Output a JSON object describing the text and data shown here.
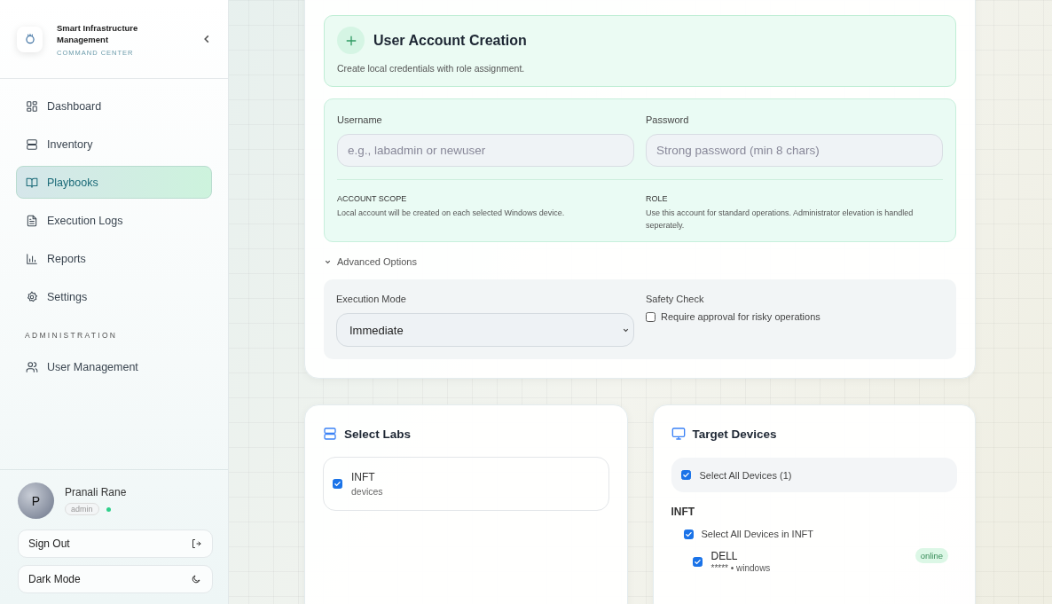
{
  "sidebar": {
    "brand": {
      "title": "Smart Infrastructure Management",
      "subtitle": "COMMAND CENTER"
    },
    "nav_items": [
      {
        "label": "Dashboard",
        "selected": false
      },
      {
        "label": "Inventory",
        "selected": false
      },
      {
        "label": "Playbooks",
        "selected": true
      },
      {
        "label": "Execution Logs",
        "selected": false
      },
      {
        "label": "Reports",
        "selected": false
      },
      {
        "label": "Settings",
        "selected": false
      }
    ],
    "section_label": "ADMINISTRATION",
    "admin_items": [
      {
        "label": "User Management",
        "selected": false
      }
    ],
    "user": {
      "initial": "P",
      "name": "Pranali Rane",
      "role": "admin",
      "online": true
    },
    "buttons": [
      {
        "label": "Sign Out"
      },
      {
        "label": "Dark Mode"
      }
    ]
  },
  "creation": {
    "title": "User Account Creation",
    "description": "Create local credentials with role assignment.",
    "fields": [
      {
        "label": "Username",
        "placeholder": "e.g., labadmin or newuser"
      },
      {
        "label": "Password",
        "placeholder": "Strong password (min 8 chars)"
      }
    ],
    "info": [
      {
        "label": "ACCOUNT SCOPE",
        "text": "Local account will be created on each selected Windows device."
      },
      {
        "label": "ROLE",
        "text": "Use this account for standard operations. Administrator elevation is handled seperately."
      }
    ],
    "advanced": {
      "label": "Advanced Options",
      "expanded": true
    },
    "execution_mode": {
      "label": "Execution Mode",
      "value": "Immediate"
    },
    "safety": {
      "label": "Safety Check",
      "option": "Require approval for risky operations",
      "checked": false
    }
  },
  "labs": {
    "title": "Select Labs",
    "items": [
      {
        "name": "INFT",
        "sub": "devices",
        "checked": true
      }
    ]
  },
  "devices": {
    "title": "Target Devices",
    "select_all": {
      "label": "Select All Devices (1)",
      "checked": true
    },
    "groups": [
      {
        "name": "INFT",
        "select_all": {
          "label": "Select All Devices in INFT",
          "checked": true
        },
        "devices": [
          {
            "name": "DELL",
            "meta": "***** • windows",
            "checked": true,
            "status": "online"
          }
        ]
      }
    ]
  }
}
